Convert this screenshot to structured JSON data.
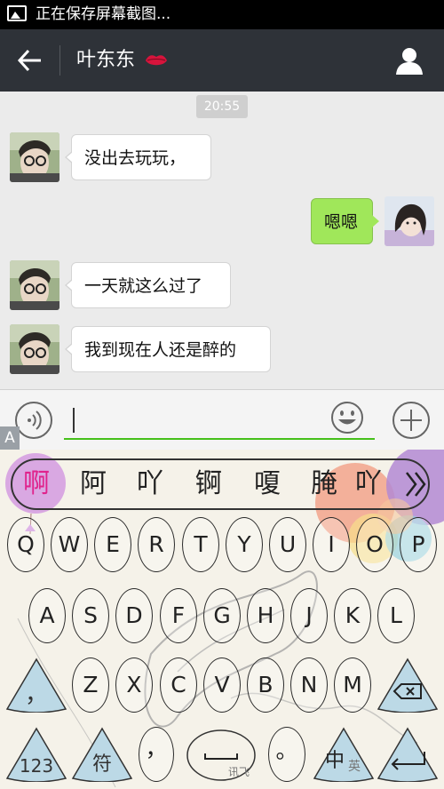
{
  "status_bar": {
    "text": "正在保存屏幕截图..."
  },
  "title_bar": {
    "contact_name": "叶东东",
    "back_icon": "back-arrow-icon",
    "profile_icon": "person-icon",
    "emoji_after_name": "lips-icon"
  },
  "chat": {
    "timestamp": "20:55",
    "messages": [
      {
        "side": "left",
        "text": "没出去玩玩，"
      },
      {
        "side": "right",
        "text": "嗯嗯"
      },
      {
        "side": "left",
        "text": "一天就这么过了"
      },
      {
        "side": "left",
        "text": "我到现在人还是醉的"
      }
    ]
  },
  "input_bar": {
    "value": "",
    "voice_icon": "voice-icon",
    "emoji_icon": "emoji-icon",
    "plus_icon": "plus-icon",
    "side_mark": "A"
  },
  "keyboard": {
    "candidates": [
      "啊",
      "阿",
      "吖",
      "锕",
      "嗄",
      "腌",
      "吖"
    ],
    "row1": [
      "Q",
      "W",
      "E",
      "R",
      "T",
      "Y",
      "U",
      "I",
      "O",
      "P"
    ],
    "row2": [
      "A",
      "S",
      "D",
      "F",
      "G",
      "H",
      "J",
      "K",
      "L"
    ],
    "row3": [
      "Z",
      "X",
      "C",
      "V",
      "B",
      "N",
      "M"
    ],
    "comma": "，",
    "num_key": "123",
    "symbol_key": "符",
    "small_comma": "，",
    "space_brand": "讯飞",
    "period": "。",
    "lang_main": "中",
    "lang_alt": "英"
  },
  "colors": {
    "accent_green": "#45c01a",
    "bubble_green": "#a0e75a",
    "header": "#2e3238",
    "candidate_highlight": "#e0238c"
  }
}
